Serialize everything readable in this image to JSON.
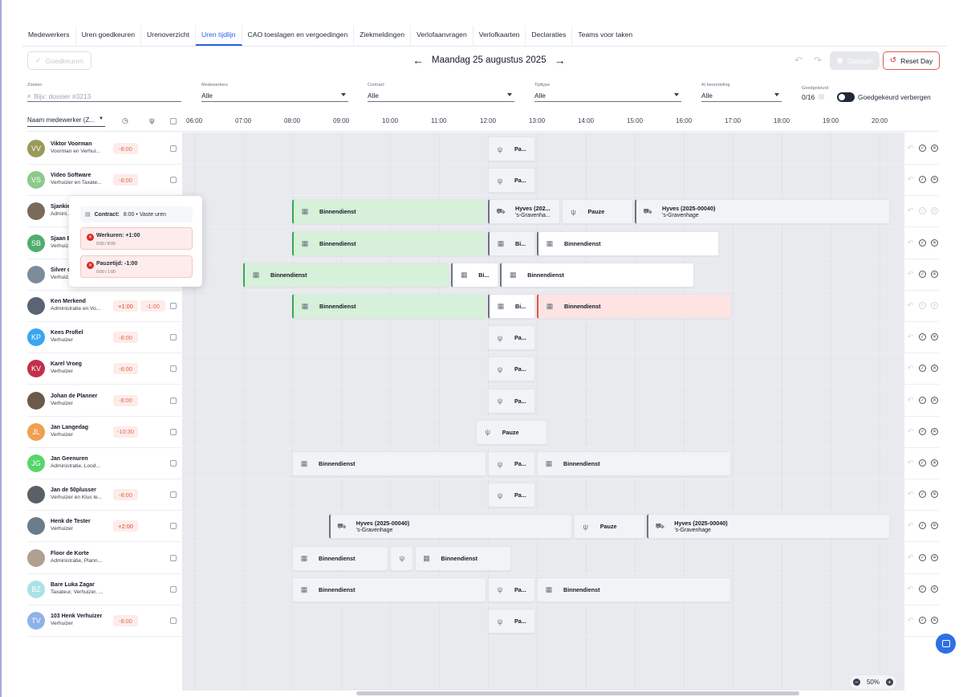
{
  "tabs": [
    "Medewerkers",
    "Uren goedkeuren",
    "Urenoverzicht",
    "Uren tijdlijn",
    "CAO toeslagen en vergoedingen",
    "Ziekmeldingen",
    "Verlofaanvragen",
    "Verlofkaarten",
    "Declaraties",
    "Teams voor taken"
  ],
  "active_tab": "Uren tijdlijn",
  "toolbar": {
    "approve": "Goedkeuren",
    "date": "Maandag 25 augustus 2025",
    "save": "Opslaan",
    "reset": "Reset Day"
  },
  "filters": {
    "search_label": "Zoeken",
    "search_placeholder": "Bijv: dossier #3213",
    "employees_label": "Medewerkers",
    "employees_value": "Alle",
    "contract_label": "Contract",
    "contract_value": "Alle",
    "timetype_label": "Tijdtype",
    "timetype_value": "Alle",
    "ai_label": "AI beoordeling",
    "ai_value": "Alle",
    "approved_label": "Goedgekeurd",
    "approved_value": "0/16",
    "hide_label": "Goedgekeurd verbergen"
  },
  "grid": {
    "sort_label": "Naam medewerker (Z...",
    "hours": [
      "06:00",
      "07:00",
      "08:00",
      "09:00",
      "10:00",
      "11:00",
      "12:00",
      "13:00",
      "14:00",
      "15:00",
      "16:00",
      "17:00",
      "18:00",
      "19:00",
      "20:00"
    ]
  },
  "employees": [
    {
      "initials": "VV",
      "name": "Viktor Voorman",
      "role": "Voorman en Verhui...",
      "badges": [
        "-8:00"
      ],
      "color": "#9a9a5a"
    },
    {
      "initials": "VS",
      "name": "Video Software",
      "role": "Verhuizer en Taxate...",
      "badges": [
        "-8:00"
      ],
      "color": "#8cc98a"
    },
    {
      "initials": "",
      "name": "Sjankie",
      "role": "Admini...",
      "badges": [],
      "color": "#7a6a5a"
    },
    {
      "initials": "SB",
      "name": "Sjaan B",
      "role": "Verhuiz...",
      "badges": [],
      "color": "#4fae6b"
    },
    {
      "initials": "",
      "name": "Silver d",
      "role": "Verhuiz...",
      "badges": [],
      "color": "#7d8c9a"
    },
    {
      "initials": "",
      "name": "Ken Merkend",
      "role": "Administratie en Vo...",
      "badges": [
        "+1:00",
        "-1:00"
      ],
      "color": "#5a6472"
    },
    {
      "initials": "KP",
      "name": "Kees Profiel",
      "role": "Verhuizer",
      "badges": [
        "-8:00"
      ],
      "color": "#3aa6f0"
    },
    {
      "initials": "KV",
      "name": "Karel Vroeg",
      "role": "Verhuizer",
      "badges": [
        "-8:00"
      ],
      "color": "#c22f4a"
    },
    {
      "initials": "",
      "name": "Johan de Planner",
      "role": "Verhuizer",
      "badges": [
        "-8:00"
      ],
      "color": "#6a5a48"
    },
    {
      "initials": "JL",
      "name": "Jan Langedag",
      "role": "Verhuizer",
      "badges": [
        "-10:30"
      ],
      "color": "#f0a050"
    },
    {
      "initials": "JG",
      "name": "Jan Geenuren",
      "role": "Administratie, Lood...",
      "badges": [],
      "color": "#56d66a"
    },
    {
      "initials": "",
      "name": "Jan de 50plusser",
      "role": "Verhuizer en Klus le...",
      "badges": [
        "-8:00"
      ],
      "color": "#5a6068"
    },
    {
      "initials": "",
      "name": "Henk de Tester",
      "role": "Verhuizer",
      "badges": [
        "+2:00"
      ],
      "color": "#6a7c8c"
    },
    {
      "initials": "",
      "name": "Floor de Korte",
      "role": "Administratie, Plann...",
      "badges": [],
      "color": "#b0a090"
    },
    {
      "initials": "BZ",
      "name": "Bare Luka Zagar",
      "role": "Taxateur, Verhuizer, ...",
      "badges": [],
      "color": "#a9e3e6"
    },
    {
      "initials": "TV",
      "name": "103 Henk Verhuizer",
      "role": "Verhuizer",
      "badges": [
        "-8:00"
      ],
      "color": "#8db2e8"
    }
  ],
  "blocks": [
    [
      {
        "start": 12.0,
        "end": 13.0,
        "type": "pause",
        "label": "Pa...",
        "style": "plain"
      }
    ],
    [
      {
        "start": 12.0,
        "end": 13.0,
        "type": "pause",
        "label": "Pa...",
        "style": "plain"
      }
    ],
    [
      {
        "start": 8.0,
        "end": 12.0,
        "type": "building",
        "label": "Binnendienst",
        "style": "green"
      },
      {
        "start": 12.0,
        "end": 13.5,
        "type": "truck",
        "label": "Hyves (202...",
        "sub": "'s-Gravenha...",
        "style": "lb"
      },
      {
        "start": 13.5,
        "end": 15.0,
        "type": "pause",
        "label": "Pauze",
        "style": "plain"
      },
      {
        "start": 15.0,
        "end": 20.25,
        "type": "truck",
        "label": "Hyves (2025-00040)",
        "sub": "'s-Gravenhage",
        "style": "lb"
      }
    ],
    [
      {
        "start": 8.0,
        "end": 12.0,
        "type": "building",
        "label": "Binnendienst",
        "style": "green"
      },
      {
        "start": 12.0,
        "end": 13.0,
        "type": "building",
        "label": "Bi...",
        "style": "lb"
      },
      {
        "start": 13.0,
        "end": 16.75,
        "type": "building",
        "label": "Binnendienst",
        "style": "white lb"
      }
    ],
    [
      {
        "start": 7.0,
        "end": 11.25,
        "type": "building",
        "label": "Binnendienst",
        "style": "green"
      },
      {
        "start": 11.25,
        "end": 12.25,
        "type": "building",
        "label": "Bi...",
        "style": "white lb"
      },
      {
        "start": 12.25,
        "end": 16.25,
        "type": "building",
        "label": "Binnendienst",
        "style": "white lb"
      }
    ],
    [
      {
        "start": 8.0,
        "end": 12.0,
        "type": "building",
        "label": "Binnendienst",
        "style": "green"
      },
      {
        "start": 12.0,
        "end": 13.0,
        "type": "building",
        "label": "Bi...",
        "style": "white lb"
      },
      {
        "start": 13.0,
        "end": 17.0,
        "type": "building",
        "label": "Binnendienst",
        "style": "red"
      }
    ],
    [
      {
        "start": 12.0,
        "end": 13.0,
        "type": "pause",
        "label": "Pa...",
        "style": "plain"
      }
    ],
    [
      {
        "start": 12.0,
        "end": 13.0,
        "type": "pause",
        "label": "Pa...",
        "style": "plain"
      }
    ],
    [
      {
        "start": 12.0,
        "end": 13.0,
        "type": "pause",
        "label": "Pa...",
        "style": "plain"
      }
    ],
    [
      {
        "start": 11.75,
        "end": 13.25,
        "type": "pause",
        "label": "Pauze",
        "style": "plain"
      }
    ],
    [
      {
        "start": 8.0,
        "end": 12.0,
        "type": "building",
        "label": "Binnendienst",
        "style": "plain"
      },
      {
        "start": 12.0,
        "end": 13.0,
        "type": "pause",
        "label": "Pa...",
        "style": "plain"
      },
      {
        "start": 13.0,
        "end": 17.0,
        "type": "building",
        "label": "Binnendienst",
        "style": "plain"
      }
    ],
    [
      {
        "start": 12.0,
        "end": 13.0,
        "type": "pause",
        "label": "Pa...",
        "style": "plain"
      }
    ],
    [
      {
        "start": 8.75,
        "end": 13.75,
        "type": "truck",
        "label": "Hyves (2025-00040)",
        "sub": "'s-Gravenhage",
        "style": "lb"
      },
      {
        "start": 13.75,
        "end": 15.25,
        "type": "pause",
        "label": "Pauze",
        "style": "plain"
      },
      {
        "start": 15.25,
        "end": 20.25,
        "type": "truck",
        "label": "Hyves (2025-00040)",
        "sub": "'s-Gravenhage",
        "style": "lb"
      }
    ],
    [
      {
        "start": 8.0,
        "end": 10.0,
        "type": "building",
        "label": "Binnendienst",
        "style": "plain"
      },
      {
        "start": 10.0,
        "end": 10.5,
        "type": "pause",
        "label": "",
        "style": "plain"
      },
      {
        "start": 10.5,
        "end": 12.5,
        "type": "building",
        "label": "Binnendienst",
        "style": "plain"
      }
    ],
    [
      {
        "start": 8.0,
        "end": 12.0,
        "type": "building",
        "label": "Binnendienst",
        "style": "plain"
      },
      {
        "start": 12.0,
        "end": 13.0,
        "type": "pause",
        "label": "Pa...",
        "style": "plain"
      },
      {
        "start": 13.0,
        "end": 17.0,
        "type": "building",
        "label": "Binnendienst",
        "style": "plain"
      }
    ],
    [
      {
        "start": 12.0,
        "end": 13.0,
        "type": "pause",
        "label": "Pa...",
        "style": "plain"
      }
    ]
  ],
  "popover": {
    "contract": "Contract:",
    "contract_value": "8:00 • Vaste uren",
    "err1_title": "Werkuren: +1:00",
    "err1_sub": "9:00 / 8:00",
    "err2_title": "Pauzetijd: -1:00",
    "err2_sub": "0:00 / 1:00"
  },
  "zoom": "50%"
}
